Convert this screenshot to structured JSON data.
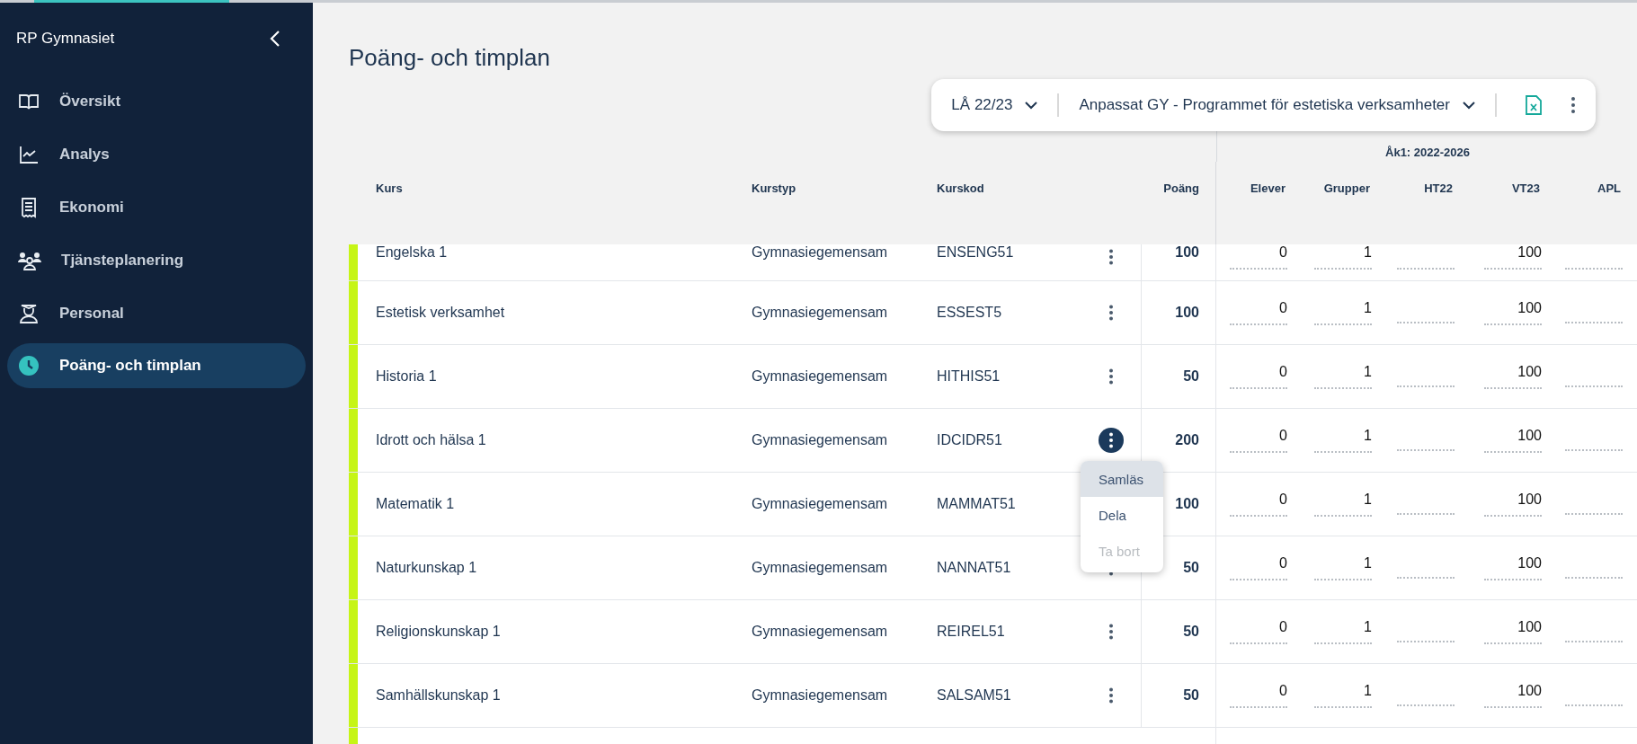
{
  "sidebar": {
    "title": "RP Gymnasiet",
    "items": [
      {
        "label": "Översikt",
        "selected": false
      },
      {
        "label": "Analys",
        "selected": false
      },
      {
        "label": "Ekonomi",
        "selected": false
      },
      {
        "label": "Tjänsteplanering",
        "selected": false
      },
      {
        "label": "Personal",
        "selected": false
      },
      {
        "label": "Poäng- och timplan",
        "selected": true
      }
    ]
  },
  "page": {
    "title": "Poäng- och timplan"
  },
  "toolbar": {
    "year": "LÅ 22/23",
    "program": "Anpassat GY - Programmet för estetiska verksamheter"
  },
  "table": {
    "group_header": "Åk1: 2022-2026",
    "columns": [
      "Kurs",
      "Kurstyp",
      "Kurskod",
      "Poäng",
      "Elever",
      "Grupper",
      "HT22",
      "VT23",
      "APL"
    ],
    "rows": [
      {
        "course": "Engelska 1",
        "type": "Gymnasiegemensam",
        "code": "ENSENG51",
        "points": "100",
        "students": "0",
        "groups": "1",
        "vt23": "100",
        "menu_open": false
      },
      {
        "course": "Estetisk verksamhet",
        "type": "Gymnasiegemensam",
        "code": "ESSEST5",
        "points": "100",
        "students": "0",
        "groups": "1",
        "vt23": "100",
        "menu_open": false
      },
      {
        "course": "Historia 1",
        "type": "Gymnasiegemensam",
        "code": "HITHIS51",
        "points": "50",
        "students": "0",
        "groups": "1",
        "vt23": "100",
        "menu_open": false
      },
      {
        "course": "Idrott och hälsa 1",
        "type": "Gymnasiegemensam",
        "code": "IDCIDR51",
        "points": "200",
        "students": "0",
        "groups": "1",
        "vt23": "100",
        "menu_open": true
      },
      {
        "course": "Matematik 1",
        "type": "Gymnasiegemensam",
        "code": "MAMMAT51",
        "points": "100",
        "students": "0",
        "groups": "1",
        "vt23": "100",
        "menu_open": false
      },
      {
        "course": "Naturkunskap 1",
        "type": "Gymnasiegemensam",
        "code": "NANNAT51",
        "points": "50",
        "students": "0",
        "groups": "1",
        "vt23": "100",
        "menu_open": false
      },
      {
        "course": "Religionskunskap 1",
        "type": "Gymnasiegemensam",
        "code": "REIREL51",
        "points": "50",
        "students": "0",
        "groups": "1",
        "vt23": "100",
        "menu_open": false
      },
      {
        "course": "Samhällskunskap 1",
        "type": "Gymnasiegemensam",
        "code": "SALSAM51",
        "points": "50",
        "students": "0",
        "groups": "1",
        "vt23": "100",
        "menu_open": false
      }
    ]
  },
  "row_menu": {
    "items": [
      {
        "label": "Samläs",
        "highlighted": true,
        "disabled": false
      },
      {
        "label": "Dela",
        "highlighted": false,
        "disabled": false
      },
      {
        "label": "Ta bort",
        "highlighted": false,
        "disabled": true
      }
    ]
  }
}
